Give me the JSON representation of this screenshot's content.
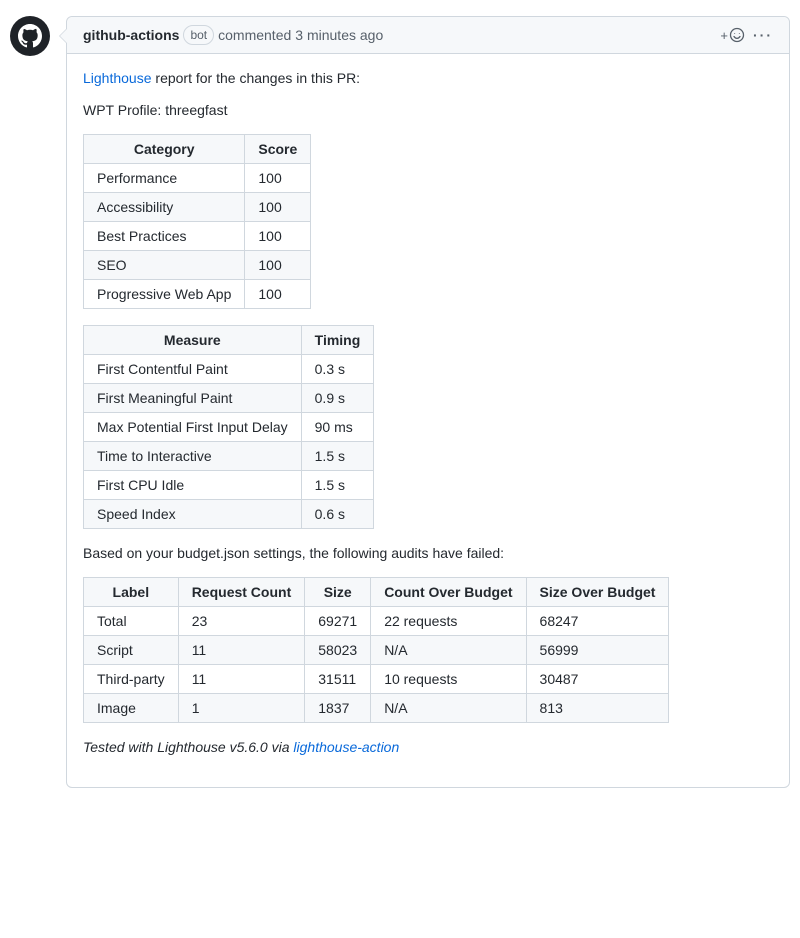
{
  "header": {
    "author": "github-actions",
    "bot_label": "bot",
    "commented": "commented",
    "time": "3 minutes ago"
  },
  "body": {
    "link_lighthouse": "Lighthouse",
    "intro_rest": " report for the changes in this PR:",
    "wpt_profile_label": "WPT Profile: ",
    "wpt_profile_value": "threegfast",
    "budget_fail_text": "Based on your budget.json settings, the following audits have failed:",
    "tested_prefix": "Tested with Lighthouse v5.6.0 via ",
    "tested_link": "lighthouse-action"
  },
  "tables": {
    "scores": {
      "head": [
        "Category",
        "Score"
      ],
      "rows": [
        [
          "Performance",
          "100"
        ],
        [
          "Accessibility",
          "100"
        ],
        [
          "Best Practices",
          "100"
        ],
        [
          "SEO",
          "100"
        ],
        [
          "Progressive Web App",
          "100"
        ]
      ]
    },
    "timings": {
      "head": [
        "Measure",
        "Timing"
      ],
      "rows": [
        [
          "First Contentful Paint",
          "0.3 s"
        ],
        [
          "First Meaningful Paint",
          "0.9 s"
        ],
        [
          "Max Potential First Input Delay",
          "90 ms"
        ],
        [
          "Time to Interactive",
          "1.5 s"
        ],
        [
          "First CPU Idle",
          "1.5 s"
        ],
        [
          "Speed Index",
          "0.6 s"
        ]
      ]
    },
    "budget": {
      "head": [
        "Label",
        "Request Count",
        "Size",
        "Count Over Budget",
        "Size Over Budget"
      ],
      "rows": [
        [
          "Total",
          "23",
          "69271",
          "22 requests",
          "68247"
        ],
        [
          "Script",
          "11",
          "58023",
          "N/A",
          "56999"
        ],
        [
          "Third-party",
          "11",
          "31511",
          "10 requests",
          "30487"
        ],
        [
          "Image",
          "1",
          "1837",
          "N/A",
          "813"
        ]
      ]
    }
  }
}
